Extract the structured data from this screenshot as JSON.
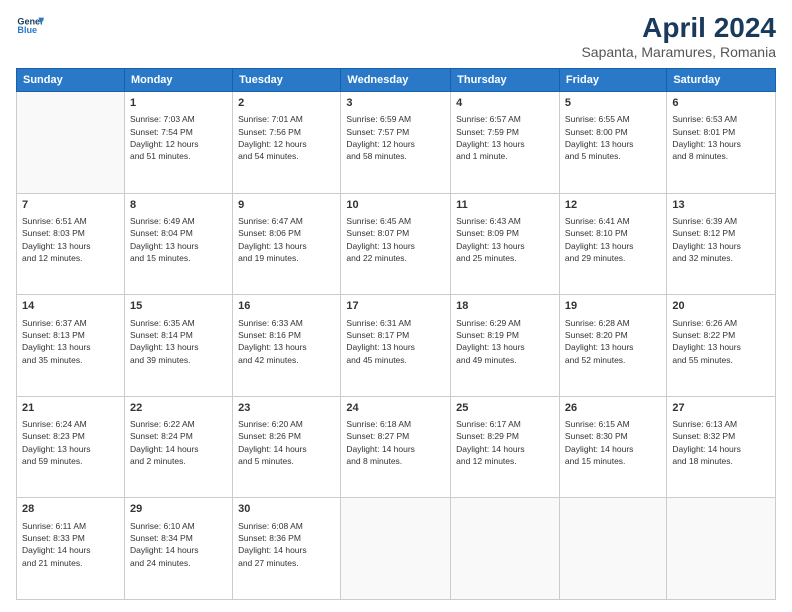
{
  "header": {
    "logo_line1": "General",
    "logo_line2": "Blue",
    "month_title": "April 2024",
    "subtitle": "Sapanta, Maramures, Romania"
  },
  "days_of_week": [
    "Sunday",
    "Monday",
    "Tuesday",
    "Wednesday",
    "Thursday",
    "Friday",
    "Saturday"
  ],
  "weeks": [
    [
      {
        "num": "",
        "info": ""
      },
      {
        "num": "1",
        "info": "Sunrise: 7:03 AM\nSunset: 7:54 PM\nDaylight: 12 hours\nand 51 minutes."
      },
      {
        "num": "2",
        "info": "Sunrise: 7:01 AM\nSunset: 7:56 PM\nDaylight: 12 hours\nand 54 minutes."
      },
      {
        "num": "3",
        "info": "Sunrise: 6:59 AM\nSunset: 7:57 PM\nDaylight: 12 hours\nand 58 minutes."
      },
      {
        "num": "4",
        "info": "Sunrise: 6:57 AM\nSunset: 7:59 PM\nDaylight: 13 hours\nand 1 minute."
      },
      {
        "num": "5",
        "info": "Sunrise: 6:55 AM\nSunset: 8:00 PM\nDaylight: 13 hours\nand 5 minutes."
      },
      {
        "num": "6",
        "info": "Sunrise: 6:53 AM\nSunset: 8:01 PM\nDaylight: 13 hours\nand 8 minutes."
      }
    ],
    [
      {
        "num": "7",
        "info": "Sunrise: 6:51 AM\nSunset: 8:03 PM\nDaylight: 13 hours\nand 12 minutes."
      },
      {
        "num": "8",
        "info": "Sunrise: 6:49 AM\nSunset: 8:04 PM\nDaylight: 13 hours\nand 15 minutes."
      },
      {
        "num": "9",
        "info": "Sunrise: 6:47 AM\nSunset: 8:06 PM\nDaylight: 13 hours\nand 19 minutes."
      },
      {
        "num": "10",
        "info": "Sunrise: 6:45 AM\nSunset: 8:07 PM\nDaylight: 13 hours\nand 22 minutes."
      },
      {
        "num": "11",
        "info": "Sunrise: 6:43 AM\nSunset: 8:09 PM\nDaylight: 13 hours\nand 25 minutes."
      },
      {
        "num": "12",
        "info": "Sunrise: 6:41 AM\nSunset: 8:10 PM\nDaylight: 13 hours\nand 29 minutes."
      },
      {
        "num": "13",
        "info": "Sunrise: 6:39 AM\nSunset: 8:12 PM\nDaylight: 13 hours\nand 32 minutes."
      }
    ],
    [
      {
        "num": "14",
        "info": "Sunrise: 6:37 AM\nSunset: 8:13 PM\nDaylight: 13 hours\nand 35 minutes."
      },
      {
        "num": "15",
        "info": "Sunrise: 6:35 AM\nSunset: 8:14 PM\nDaylight: 13 hours\nand 39 minutes."
      },
      {
        "num": "16",
        "info": "Sunrise: 6:33 AM\nSunset: 8:16 PM\nDaylight: 13 hours\nand 42 minutes."
      },
      {
        "num": "17",
        "info": "Sunrise: 6:31 AM\nSunset: 8:17 PM\nDaylight: 13 hours\nand 45 minutes."
      },
      {
        "num": "18",
        "info": "Sunrise: 6:29 AM\nSunset: 8:19 PM\nDaylight: 13 hours\nand 49 minutes."
      },
      {
        "num": "19",
        "info": "Sunrise: 6:28 AM\nSunset: 8:20 PM\nDaylight: 13 hours\nand 52 minutes."
      },
      {
        "num": "20",
        "info": "Sunrise: 6:26 AM\nSunset: 8:22 PM\nDaylight: 13 hours\nand 55 minutes."
      }
    ],
    [
      {
        "num": "21",
        "info": "Sunrise: 6:24 AM\nSunset: 8:23 PM\nDaylight: 13 hours\nand 59 minutes."
      },
      {
        "num": "22",
        "info": "Sunrise: 6:22 AM\nSunset: 8:24 PM\nDaylight: 14 hours\nand 2 minutes."
      },
      {
        "num": "23",
        "info": "Sunrise: 6:20 AM\nSunset: 8:26 PM\nDaylight: 14 hours\nand 5 minutes."
      },
      {
        "num": "24",
        "info": "Sunrise: 6:18 AM\nSunset: 8:27 PM\nDaylight: 14 hours\nand 8 minutes."
      },
      {
        "num": "25",
        "info": "Sunrise: 6:17 AM\nSunset: 8:29 PM\nDaylight: 14 hours\nand 12 minutes."
      },
      {
        "num": "26",
        "info": "Sunrise: 6:15 AM\nSunset: 8:30 PM\nDaylight: 14 hours\nand 15 minutes."
      },
      {
        "num": "27",
        "info": "Sunrise: 6:13 AM\nSunset: 8:32 PM\nDaylight: 14 hours\nand 18 minutes."
      }
    ],
    [
      {
        "num": "28",
        "info": "Sunrise: 6:11 AM\nSunset: 8:33 PM\nDaylight: 14 hours\nand 21 minutes."
      },
      {
        "num": "29",
        "info": "Sunrise: 6:10 AM\nSunset: 8:34 PM\nDaylight: 14 hours\nand 24 minutes."
      },
      {
        "num": "30",
        "info": "Sunrise: 6:08 AM\nSunset: 8:36 PM\nDaylight: 14 hours\nand 27 minutes."
      },
      {
        "num": "",
        "info": ""
      },
      {
        "num": "",
        "info": ""
      },
      {
        "num": "",
        "info": ""
      },
      {
        "num": "",
        "info": ""
      }
    ]
  ]
}
